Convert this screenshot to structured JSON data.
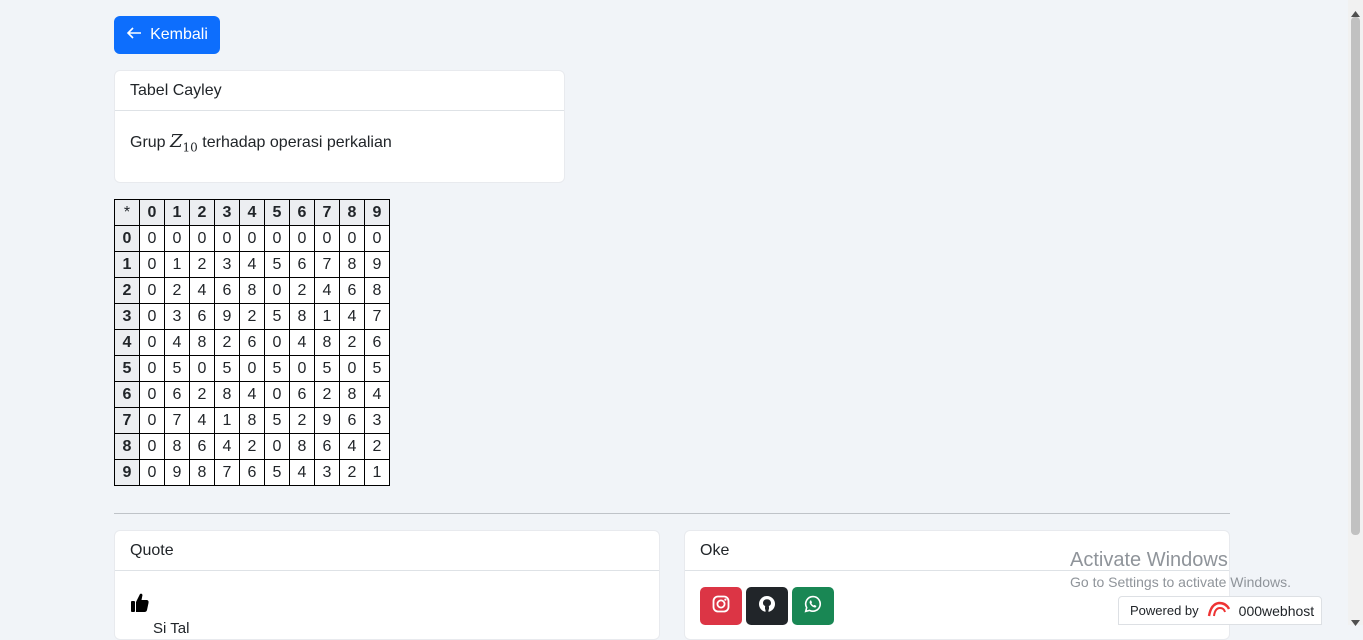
{
  "back_button": {
    "label": "Kembali",
    "icon": "arrow-left-icon"
  },
  "cayley_card": {
    "header": "Tabel Cayley",
    "body_prefix": "Grup",
    "math_symbol": "Z",
    "math_subscript": "10",
    "body_suffix": "terhadap operasi perkalian"
  },
  "table": {
    "corner": "*",
    "headers": [
      "0",
      "1",
      "2",
      "3",
      "4",
      "5",
      "6",
      "7",
      "8",
      "9"
    ],
    "rows": [
      {
        "label": "0",
        "cells": [
          "0",
          "0",
          "0",
          "0",
          "0",
          "0",
          "0",
          "0",
          "0",
          "0"
        ]
      },
      {
        "label": "1",
        "cells": [
          "0",
          "1",
          "2",
          "3",
          "4",
          "5",
          "6",
          "7",
          "8",
          "9"
        ]
      },
      {
        "label": "2",
        "cells": [
          "0",
          "2",
          "4",
          "6",
          "8",
          "0",
          "2",
          "4",
          "6",
          "8"
        ]
      },
      {
        "label": "3",
        "cells": [
          "0",
          "3",
          "6",
          "9",
          "2",
          "5",
          "8",
          "1",
          "4",
          "7"
        ]
      },
      {
        "label": "4",
        "cells": [
          "0",
          "4",
          "8",
          "2",
          "6",
          "0",
          "4",
          "8",
          "2",
          "6"
        ]
      },
      {
        "label": "5",
        "cells": [
          "0",
          "5",
          "0",
          "5",
          "0",
          "5",
          "0",
          "5",
          "0",
          "5"
        ]
      },
      {
        "label": "6",
        "cells": [
          "0",
          "6",
          "2",
          "8",
          "4",
          "0",
          "6",
          "2",
          "8",
          "4"
        ]
      },
      {
        "label": "7",
        "cells": [
          "0",
          "7",
          "4",
          "1",
          "8",
          "5",
          "2",
          "9",
          "6",
          "3"
        ]
      },
      {
        "label": "8",
        "cells": [
          "0",
          "8",
          "6",
          "4",
          "2",
          "0",
          "8",
          "6",
          "4",
          "2"
        ]
      },
      {
        "label": "9",
        "cells": [
          "0",
          "9",
          "8",
          "7",
          "6",
          "5",
          "4",
          "3",
          "2",
          "1"
        ]
      }
    ]
  },
  "quote_card": {
    "header": "Quote",
    "icon": "thumbs-up-icon",
    "partial_text": "Si Tal"
  },
  "oke_card": {
    "header": "Oke",
    "buttons": [
      {
        "name": "instagram-button",
        "icon": "instagram-icon",
        "color": "#dc3545"
      },
      {
        "name": "github-button",
        "icon": "github-icon",
        "color": "#212529"
      },
      {
        "name": "whatsapp-button",
        "icon": "whatsapp-icon",
        "color": "#198754"
      }
    ]
  },
  "watermark": {
    "title": "Activate Windows",
    "subtitle": "Go to Settings to activate Windows."
  },
  "powered_badge": {
    "prefix": "Powered by",
    "brand": "000webhost"
  },
  "colors": {
    "primary": "#0d6efd",
    "background": "#f1f4f8",
    "instagram": "#dc3545",
    "github": "#212529",
    "whatsapp": "#198754"
  }
}
